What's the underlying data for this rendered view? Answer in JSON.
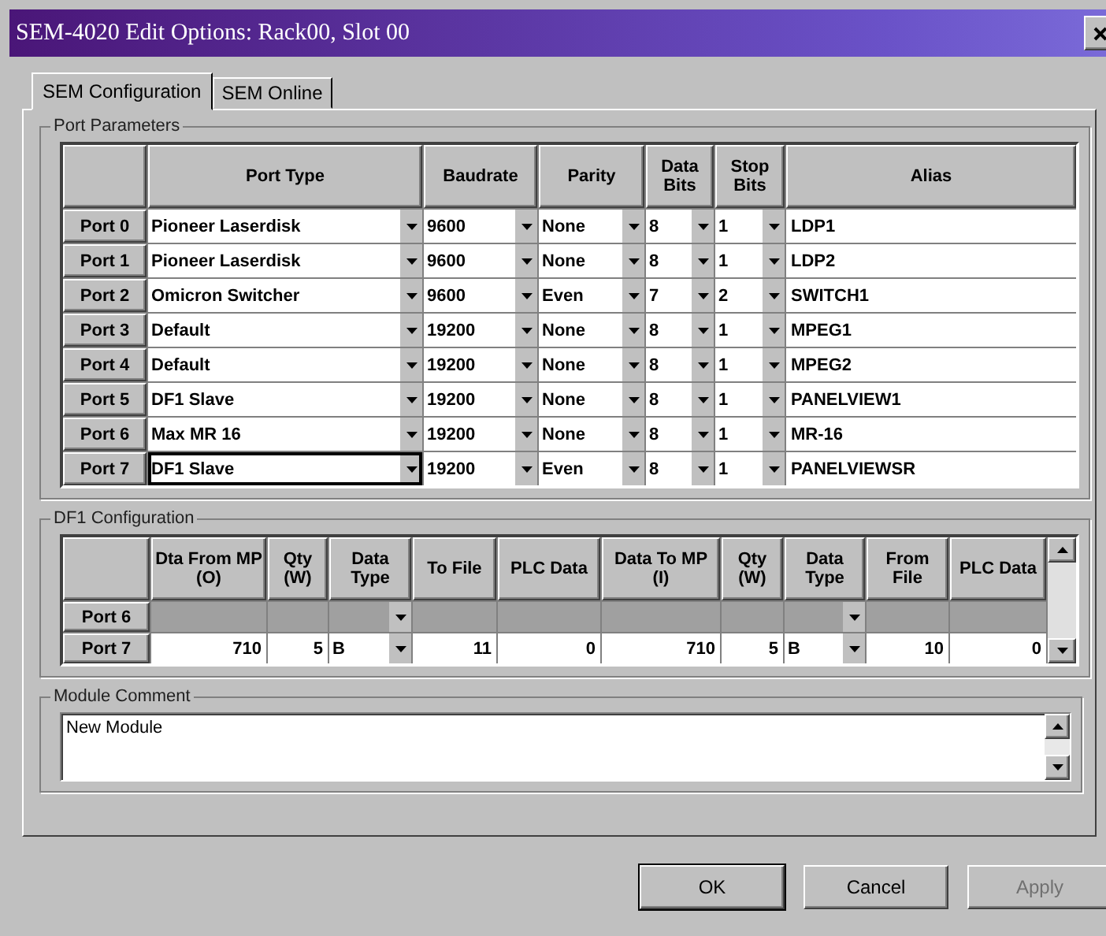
{
  "window": {
    "title": "SEM-4020 Edit Options: Rack00, Slot 00"
  },
  "tabs": [
    {
      "label": "SEM Configuration",
      "selected": true
    },
    {
      "label": "SEM Online",
      "selected": false
    }
  ],
  "port_parameters": {
    "title": "Port Parameters",
    "columns": [
      "Port Type",
      "Baudrate",
      "Parity",
      "Data Bits",
      "Stop Bits",
      "Alias"
    ],
    "rows": [
      {
        "port": "Port 0",
        "port_type": "Pioneer Laserdisk",
        "baudrate": "9600",
        "parity": "None",
        "data_bits": "8",
        "stop_bits": "1",
        "alias": "LDP1",
        "focused": false
      },
      {
        "port": "Port 1",
        "port_type": "Pioneer Laserdisk",
        "baudrate": "9600",
        "parity": "None",
        "data_bits": "8",
        "stop_bits": "1",
        "alias": "LDP2",
        "focused": false
      },
      {
        "port": "Port 2",
        "port_type": "Omicron Switcher",
        "baudrate": "9600",
        "parity": "Even",
        "data_bits": "7",
        "stop_bits": "2",
        "alias": "SWITCH1",
        "focused": false
      },
      {
        "port": "Port 3",
        "port_type": "Default",
        "baudrate": "19200",
        "parity": "None",
        "data_bits": "8",
        "stop_bits": "1",
        "alias": "MPEG1",
        "focused": false
      },
      {
        "port": "Port 4",
        "port_type": "Default",
        "baudrate": "19200",
        "parity": "None",
        "data_bits": "8",
        "stop_bits": "1",
        "alias": "MPEG2",
        "focused": false
      },
      {
        "port": "Port 5",
        "port_type": "DF1 Slave",
        "baudrate": "19200",
        "parity": "None",
        "data_bits": "8",
        "stop_bits": "1",
        "alias": "PANELVIEW1",
        "focused": false
      },
      {
        "port": "Port 6",
        "port_type": "Max MR 16",
        "baudrate": "19200",
        "parity": "None",
        "data_bits": "8",
        "stop_bits": "1",
        "alias": "MR-16",
        "focused": false
      },
      {
        "port": "Port 7",
        "port_type": "DF1 Slave",
        "baudrate": "19200",
        "parity": "Even",
        "data_bits": "8",
        "stop_bits": "1",
        "alias": "PANELVIEWSR",
        "focused": true
      }
    ]
  },
  "df1_configuration": {
    "title": "DF1 Configuration",
    "columns": [
      {
        "label": "Dta From MP (O)",
        "kind": "number"
      },
      {
        "label": "Qty (W)",
        "kind": "number"
      },
      {
        "label": "Data Type",
        "kind": "dropdown"
      },
      {
        "label": "To File",
        "kind": "number"
      },
      {
        "label": "PLC Data",
        "kind": "number"
      },
      {
        "label": "Data To MP (I)",
        "kind": "number"
      },
      {
        "label": "Qty (W)",
        "kind": "number"
      },
      {
        "label": "Data Type",
        "kind": "dropdown"
      },
      {
        "label": "From File",
        "kind": "number"
      },
      {
        "label": "PLC Data",
        "kind": "number"
      }
    ],
    "rows": [
      {
        "port": "Port 6",
        "disabled": true
      },
      {
        "port": "Port 7",
        "disabled": false,
        "values": [
          "710",
          "5",
          "B",
          "11",
          "0",
          "710",
          "5",
          "B",
          "10",
          "0"
        ]
      }
    ]
  },
  "module_comment": {
    "title": "Module Comment",
    "value": "New Module"
  },
  "buttons": [
    {
      "label": "OK",
      "default": true,
      "disabled": false
    },
    {
      "label": "Cancel",
      "default": false,
      "disabled": false
    },
    {
      "label": "Apply",
      "default": false,
      "disabled": true
    }
  ]
}
